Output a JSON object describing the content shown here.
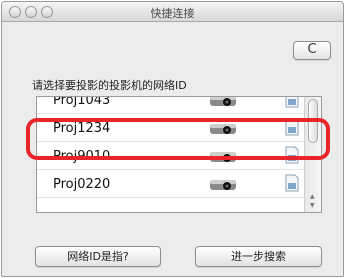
{
  "window": {
    "title": "快捷连接"
  },
  "toolbar": {
    "refresh_icon": "refresh-icon",
    "refresh_glyph": "C"
  },
  "prompt": "请选择要投影的投影机的网络ID",
  "projectors": [
    {
      "name": "Proj1043"
    },
    {
      "name": "Proj1234",
      "selected": true
    },
    {
      "name": "Proj9010"
    },
    {
      "name": "Proj0220"
    }
  ],
  "buttons": {
    "what_is_id": "网络ID是指?",
    "advanced_search": "进一步搜索"
  },
  "colors": {
    "highlight": "#e8252b",
    "window_bg": "#ececec"
  }
}
